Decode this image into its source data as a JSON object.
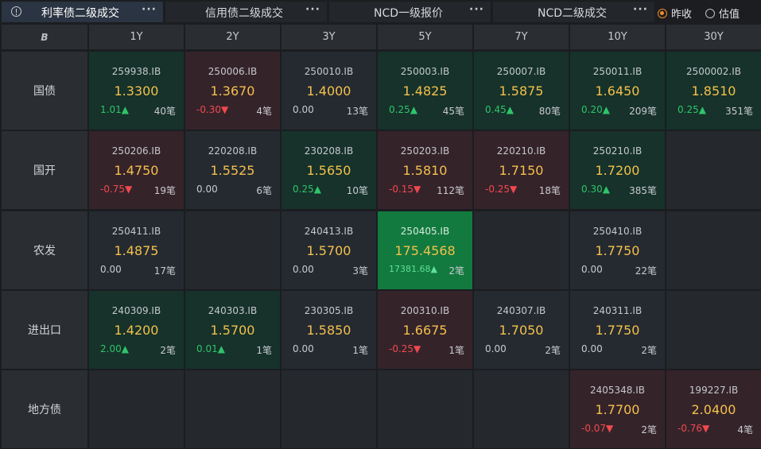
{
  "tabs": [
    {
      "label": "利率债二级成交",
      "more": "···",
      "active": true
    },
    {
      "label": "信用债二级成交",
      "more": "···",
      "active": false
    },
    {
      "label": "NCD一级报价",
      "more": "···",
      "active": false
    },
    {
      "label": "NCD二级成交",
      "more": "···",
      "active": false
    }
  ],
  "radio_options": [
    {
      "label": "昨收",
      "checked": true
    },
    {
      "label": "估值",
      "checked": false
    }
  ],
  "corner_logo": "B",
  "columns": [
    "1Y",
    "2Y",
    "3Y",
    "5Y",
    "7Y",
    "10Y",
    "30Y"
  ],
  "rows": [
    {
      "label": "国债",
      "cells": [
        {
          "code": "259938.IB",
          "price": "1.3300",
          "change": "1.01▲",
          "count": "40笔",
          "state": "up"
        },
        {
          "code": "250006.IB",
          "price": "1.3670",
          "change": "-0.30▼",
          "count": "4笔",
          "state": "down"
        },
        {
          "code": "250010.IB",
          "price": "1.4000",
          "change": "0.00",
          "count": "13笔",
          "state": "flat"
        },
        {
          "code": "250003.IB",
          "price": "1.4825",
          "change": "0.25▲",
          "count": "45笔",
          "state": "up"
        },
        {
          "code": "250007.IB",
          "price": "1.5875",
          "change": "0.45▲",
          "count": "80笔",
          "state": "up"
        },
        {
          "code": "250011.IB",
          "price": "1.6450",
          "change": "0.20▲",
          "count": "209笔",
          "state": "up"
        },
        {
          "code": "2500002.IB",
          "price": "1.8510",
          "change": "0.25▲",
          "count": "351笔",
          "state": "up"
        }
      ]
    },
    {
      "label": "国开",
      "cells": [
        {
          "code": "250206.IB",
          "price": "1.4750",
          "change": "-0.75▼",
          "count": "19笔",
          "state": "down"
        },
        {
          "code": "220208.IB",
          "price": "1.5525",
          "change": "0.00",
          "count": "6笔",
          "state": "flat"
        },
        {
          "code": "230208.IB",
          "price": "1.5650",
          "change": "0.25▲",
          "count": "10笔",
          "state": "up"
        },
        {
          "code": "250203.IB",
          "price": "1.5810",
          "change": "-0.15▼",
          "count": "112笔",
          "state": "down"
        },
        {
          "code": "220210.IB",
          "price": "1.7150",
          "change": "-0.25▼",
          "count": "18笔",
          "state": "down"
        },
        {
          "code": "250210.IB",
          "price": "1.7200",
          "change": "0.30▲",
          "count": "385笔",
          "state": "up"
        },
        null
      ]
    },
    {
      "label": "农发",
      "cells": [
        {
          "code": "250411.IB",
          "price": "1.4875",
          "change": "0.00",
          "count": "17笔",
          "state": "flat"
        },
        null,
        {
          "code": "240413.IB",
          "price": "1.5700",
          "change": "0.00",
          "count": "3笔",
          "state": "flat"
        },
        {
          "code": "250405.IB",
          "price": "175.4568",
          "change": "17381.68▲",
          "count": "2笔",
          "state": "hot"
        },
        null,
        {
          "code": "250410.IB",
          "price": "1.7750",
          "change": "0.00",
          "count": "22笔",
          "state": "flat"
        },
        null
      ]
    },
    {
      "label": "进出口",
      "cells": [
        {
          "code": "240309.IB",
          "price": "1.4200",
          "change": "2.00▲",
          "count": "2笔",
          "state": "up"
        },
        {
          "code": "240303.IB",
          "price": "1.5700",
          "change": "0.01▲",
          "count": "1笔",
          "state": "up"
        },
        {
          "code": "230305.IB",
          "price": "1.5850",
          "change": "0.00",
          "count": "1笔",
          "state": "flat"
        },
        {
          "code": "200310.IB",
          "price": "1.6675",
          "change": "-0.25▼",
          "count": "1笔",
          "state": "down"
        },
        {
          "code": "240307.IB",
          "price": "1.7050",
          "change": "0.00",
          "count": "2笔",
          "state": "flat"
        },
        {
          "code": "240311.IB",
          "price": "1.7750",
          "change": "0.00",
          "count": "2笔",
          "state": "flat"
        },
        null
      ]
    },
    {
      "label": "地方债",
      "cells": [
        null,
        null,
        null,
        null,
        null,
        {
          "code": "2405348.IB",
          "price": "1.7700",
          "change": "-0.07▼",
          "count": "2笔",
          "state": "down"
        },
        {
          "code": "199227.IB",
          "price": "2.0400",
          "change": "-0.76▼",
          "count": "4笔",
          "state": "down"
        }
      ]
    }
  ]
}
